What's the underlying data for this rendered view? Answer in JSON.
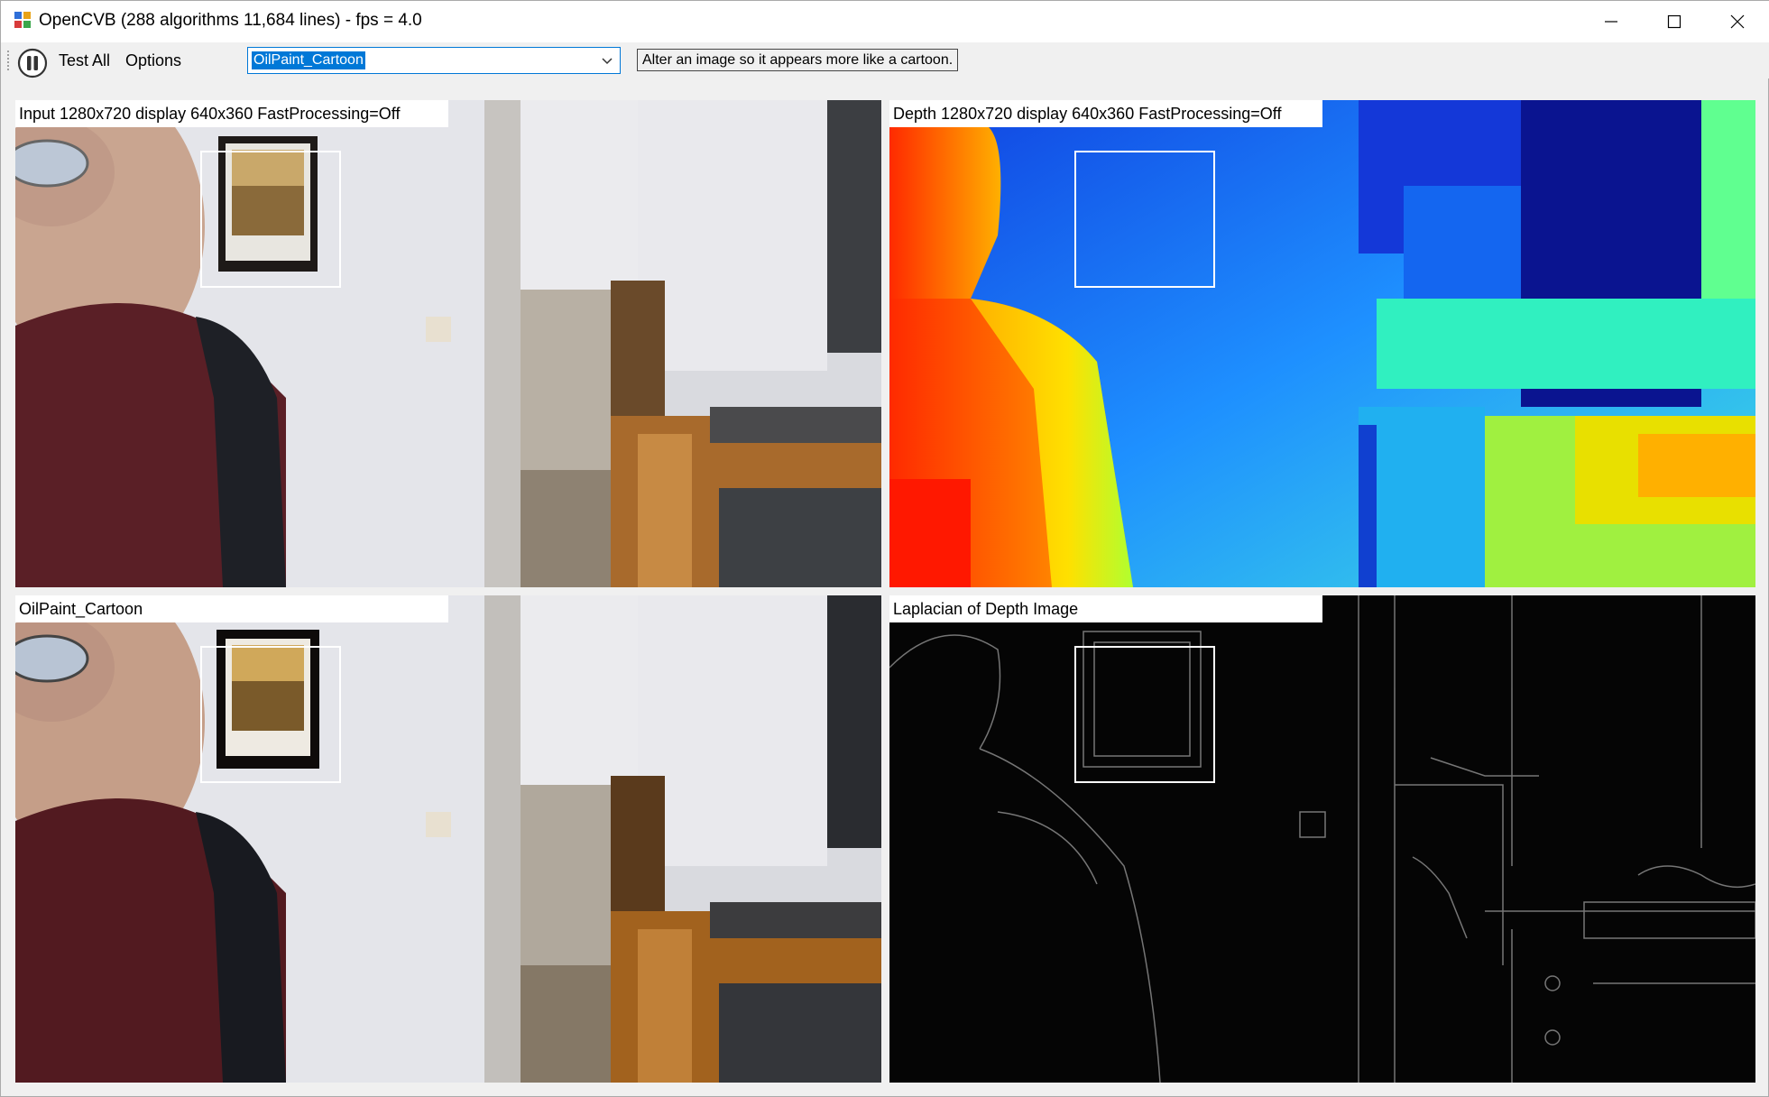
{
  "window": {
    "title": "OpenCVB (288 algorithms 11,684 lines) - fps = 4.0"
  },
  "toolbar": {
    "test_all_label": "Test All",
    "options_label": "Options",
    "algorithm_selected": "OilPaint_Cartoon",
    "algorithm_description": "Alter an image so it appears more like a cartoon."
  },
  "panels": {
    "input_label": "Input 1280x720 display 640x360 FastProcessing=Off",
    "depth_label": "Depth 1280x720 display 640x360 FastProcessing=Off",
    "result1_label": "OilPaint_Cartoon",
    "result2_label": "Laplacian of Depth Image"
  },
  "icons": {
    "app": "opencvb-app-icon",
    "pause": "pause-icon",
    "minimize": "minimize-icon",
    "maximize": "maximize-icon",
    "close": "close-icon",
    "dropdown": "chevron-down-icon"
  },
  "colors": {
    "selection": "#0078d7",
    "roi": "#ffffff"
  }
}
